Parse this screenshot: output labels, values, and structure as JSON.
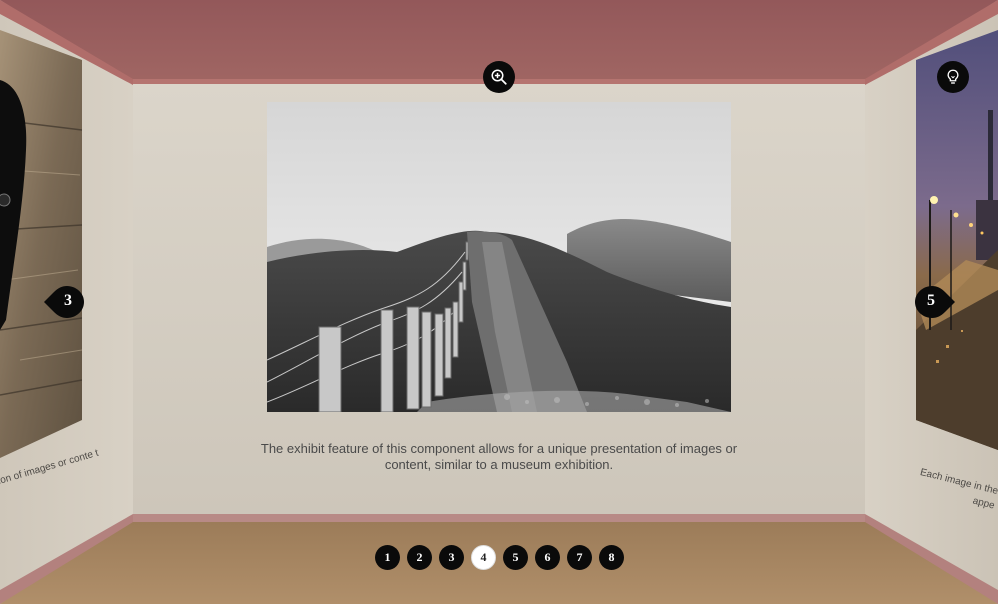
{
  "exhibit": {
    "caption": "The exhibit feature of this component allows for a unique presentation of images or content, similar to a museum exhibition.",
    "image_icon": "landscape-hill-fence-photo"
  },
  "left_exhibit": {
    "caption": "ection of images or conte t",
    "image_icon": "dog-on-wood-photo"
  },
  "right_exhibit": {
    "caption_line1": "Each image in the slider",
    "caption_line2": "appe",
    "image_icon": "night-city-street-photo"
  },
  "nav": {
    "prev_label": "3",
    "next_label": "5"
  },
  "controls": {
    "zoom_icon": "zoom-in-icon",
    "info_icon": "lightbulb-icon"
  },
  "pagination": {
    "pages": [
      "1",
      "2",
      "3",
      "4",
      "5",
      "6",
      "7",
      "8"
    ],
    "active": "4"
  },
  "colors": {
    "ceiling": "#965a58",
    "floor": "#a3825f",
    "wall": "#d6cfc4",
    "control": "#0a0a0a"
  }
}
